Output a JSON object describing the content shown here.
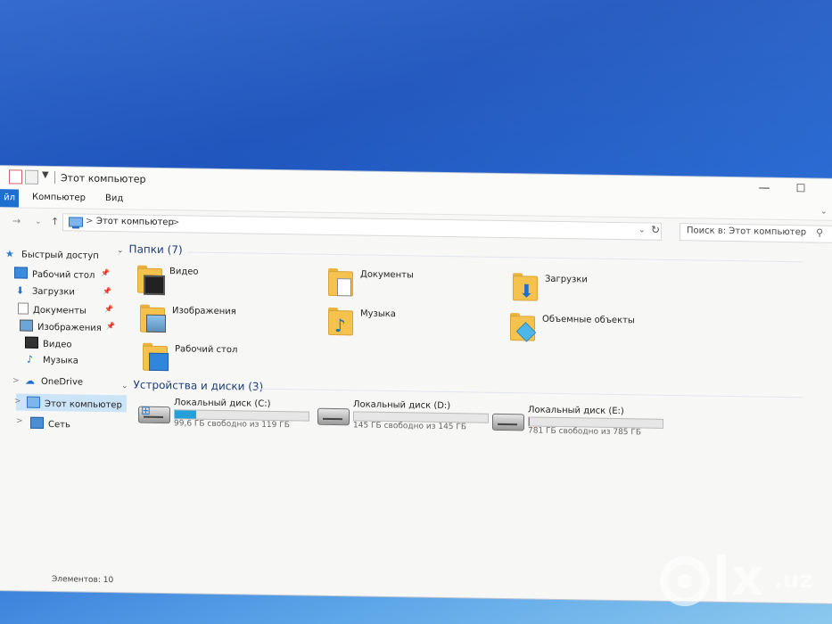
{
  "window": {
    "title": "Этот компьютер",
    "min_glyph": "—",
    "max_glyph": "☐"
  },
  "ribbon": {
    "file_tab": "йл",
    "computer_tab": "Компьютер",
    "view_tab": "Вид"
  },
  "address": {
    "crumb": "Этот компьютер",
    "separator": ">",
    "search_placeholder": "Поиск в: Этот компьютер"
  },
  "nav_pane": {
    "quick_access": "Быстрый доступ",
    "items": [
      {
        "label": "Рабочий стол",
        "pinned": true
      },
      {
        "label": "Загрузки",
        "pinned": true
      },
      {
        "label": "Документы",
        "pinned": true
      },
      {
        "label": "Изображения",
        "pinned": true
      },
      {
        "label": "Видео",
        "pinned": false
      },
      {
        "label": "Музыка",
        "pinned": false
      }
    ],
    "onedrive": "OneDrive",
    "this_pc": "Этот компьютер",
    "network": "Сеть"
  },
  "folders_group": {
    "heading": "Папки (7)",
    "items": [
      {
        "label": "Видео",
        "icon": "video-folder-icon"
      },
      {
        "label": "Документы",
        "icon": "documents-folder-icon"
      },
      {
        "label": "Загрузки",
        "icon": "downloads-folder-icon"
      },
      {
        "label": "Изображения",
        "icon": "pictures-folder-icon"
      },
      {
        "label": "Музыка",
        "icon": "music-folder-icon"
      },
      {
        "label": "Объемные объекты",
        "icon": "3d-objects-folder-icon"
      },
      {
        "label": "Рабочий стол",
        "icon": "desktop-folder-icon"
      }
    ]
  },
  "drives_group": {
    "heading": "Устройства и диски (3)",
    "items": [
      {
        "name": "Локальный диск (C:)",
        "free_text": "99,6 ГБ свободно из 119 ГБ",
        "used_fraction": 0.16
      },
      {
        "name": "Локальный диск (D:)",
        "free_text": "145 ГБ свободно из 145 ГБ",
        "used_fraction": 0.0
      },
      {
        "name": "Локальный диск (E:)",
        "free_text": "781 ГБ свободно из 785 ГБ",
        "used_fraction": 0.005
      }
    ]
  },
  "status": {
    "items_count": "Элементов: 10"
  },
  "watermark": {
    "brand": "olx",
    "domain": ".uz"
  },
  "colors": {
    "accent": "#1e6fd0",
    "drive_bar": "#26a0da",
    "folder": "#f4c24d",
    "selection": "#cce4f7"
  }
}
